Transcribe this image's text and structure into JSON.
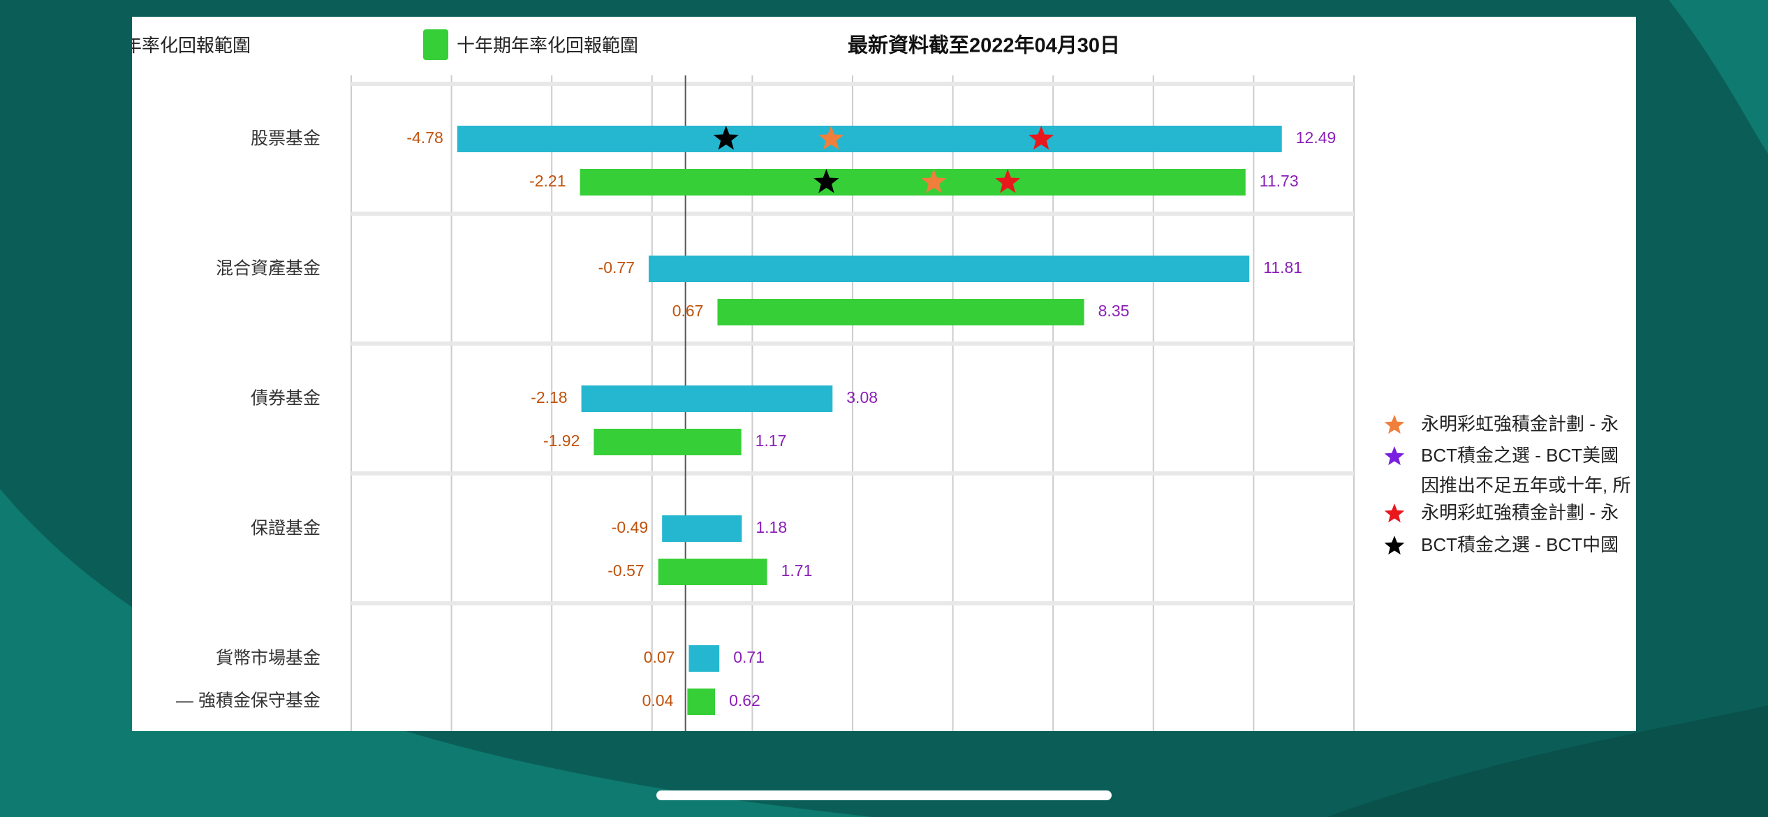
{
  "chart_data": {
    "type": "bar",
    "subtype": "range",
    "title": "最新資料截至2022年04月30日",
    "legend": [
      {
        "label": "五年期年率化回報範圍",
        "color": "#25b7cf"
      },
      {
        "label": "十年期年率化回報範圍",
        "color": "#37cf37"
      }
    ],
    "categories": [
      "股票基金",
      "混合資產基金",
      "債券基金",
      "保證基金",
      "貨幣市場基金",
      "— 強積金保守基金"
    ],
    "xlim": [
      -7,
      14
    ],
    "grid": true,
    "series": [
      {
        "name": "五年期年率化回報範圍",
        "color": "#25b7cf",
        "low": [
          -4.78,
          -0.77,
          -2.18,
          -0.49,
          0.07
        ],
        "high": [
          12.49,
          11.81,
          3.08,
          1.18,
          0.71
        ],
        "low_labels": [
          "-4.78",
          "-0.77",
          "-2.18",
          "-0.49",
          "0.07"
        ],
        "high_labels": [
          "12.49",
          "11.81",
          "3.08",
          "1.18",
          "0.71"
        ]
      },
      {
        "name": "十年期年率化回報範圍",
        "color": "#37cf37",
        "low": [
          -2.21,
          0.67,
          -1.92,
          -0.57,
          0.04
        ],
        "high": [
          11.73,
          8.35,
          1.17,
          1.71,
          0.62
        ],
        "low_labels": [
          "-2.21",
          "0.67",
          "-1.92",
          "-0.57",
          "0.04"
        ],
        "high_labels": [
          "11.73",
          "8.35",
          "1.17",
          "1.71",
          "0.62"
        ]
      }
    ],
    "bar_category_index": [
      0,
      1,
      2,
      3,
      4
    ],
    "markers": [
      {
        "series": 0,
        "category": 0,
        "value": 0.85,
        "legend": 3
      },
      {
        "series": 0,
        "category": 0,
        "value": 3.05,
        "legend": 0
      },
      {
        "series": 0,
        "category": 0,
        "value": 7.45,
        "legend": 2
      },
      {
        "series": 1,
        "category": 0,
        "value": 2.95,
        "legend": 3
      },
      {
        "series": 1,
        "category": 0,
        "value": 5.2,
        "legend": 0
      },
      {
        "series": 1,
        "category": 0,
        "value": 6.75,
        "legend": 2
      }
    ],
    "marker_legend": [
      {
        "line1": "永明彩虹強積金計劃 - 永",
        "line2": "",
        "color": "#f07f3c"
      },
      {
        "line1": "BCT積金之選 - BCT美國",
        "line2": "因推出不足五年或十年, 所",
        "color": "#7a1fe0"
      },
      {
        "line1": "永明彩虹強積金計劃 - 永",
        "line2": "",
        "color": "#e8181c"
      },
      {
        "line1": "BCT積金之選 - BCT中國",
        "line2": "",
        "color": "#000000"
      }
    ]
  },
  "colors": {
    "low_label": "#c0520c",
    "high_label": "#8a1fb8",
    "grid": "#cccccc",
    "band_separator": "#e8e8e8",
    "zero_line": "#555555",
    "background": "#0b5e57"
  }
}
